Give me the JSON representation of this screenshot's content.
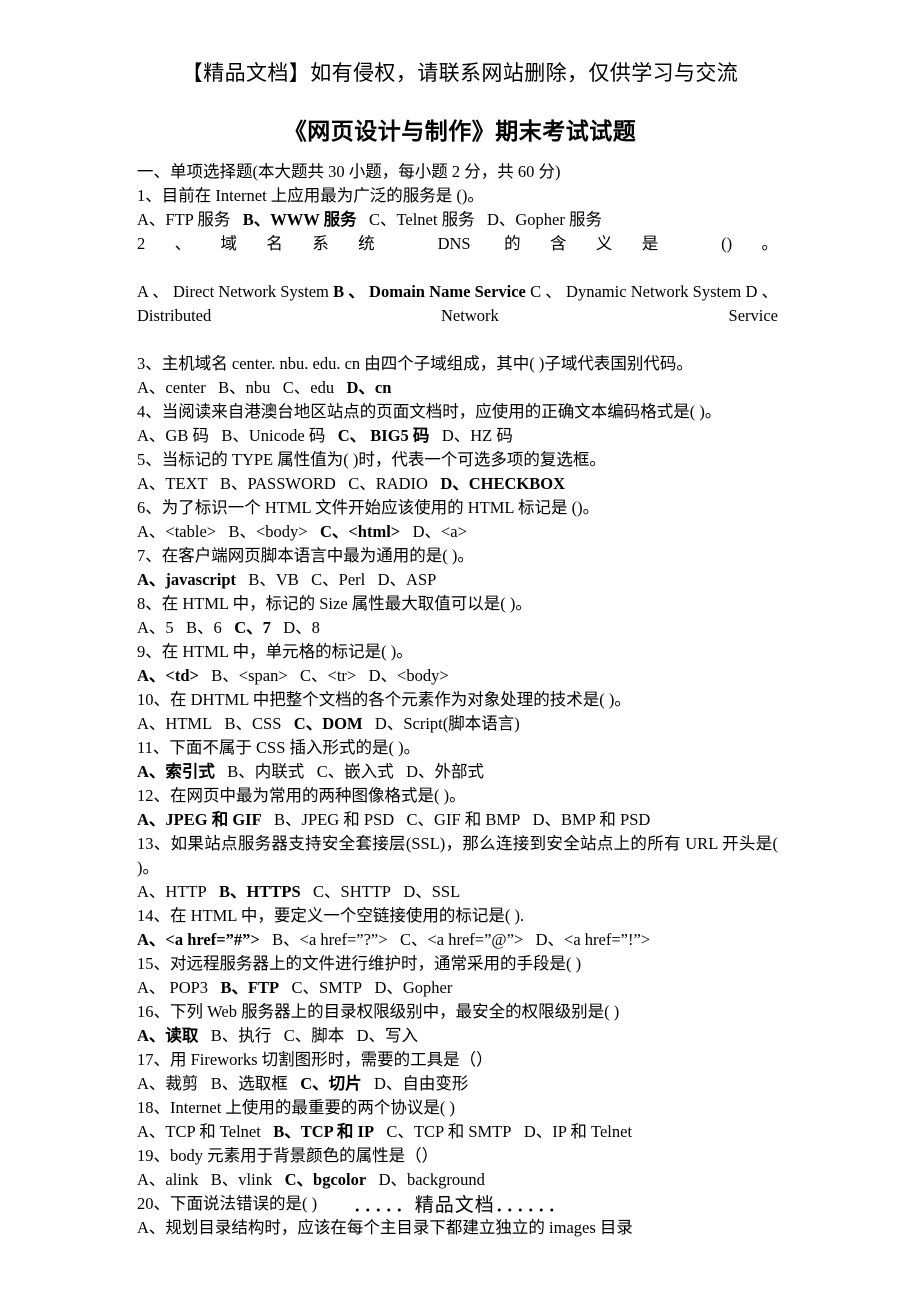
{
  "header": {
    "notice": "【精品文档】如有侵权，请联系网站删除，仅供学习与交流"
  },
  "title": "《网页设计与制作》期末考试试题",
  "section_heading": "一、单项选择题(本大题共 30 小题，每小题 2 分，共 60 分)",
  "questions": [
    {
      "number": "1",
      "stem": "1、目前在 Internet 上应用最为广泛的服务是 ()。",
      "options_text": "A、FTP 服务　B、WWW 服务　C、Telnet 服务　D、Gopher 服务",
      "options": [
        {
          "label": "A、FTP 服务",
          "bold": false
        },
        {
          "label": "B、WWW 服务",
          "bold": true
        },
        {
          "label": "C、Telnet 服务",
          "bold": false
        },
        {
          "label": "D、Gopher 服务",
          "bold": false
        }
      ],
      "answer": "B"
    },
    {
      "number": "2",
      "stem": "2、域名系统 DNS 的含义是 ()。",
      "options_text": "A、Direct Network System B、Domain Name Service C、Dynamic Network System D、Distributed Network Service",
      "options": [
        {
          "label": "A 、 Direct Network System",
          "bold": false
        },
        {
          "label": "B 、 Domain Name Service",
          "bold": true
        },
        {
          "label": "C 、 Dynamic Network System",
          "bold": false
        },
        {
          "label": "D 、 Distributed Network Service",
          "bold": false
        }
      ],
      "answer": "B",
      "wraps": true
    },
    {
      "number": "3",
      "stem": "3、主机域名 center. nbu. edu. cn 由四个子域组成，其中( )子域代表国别代码。",
      "options_text": "A、center　B、nbu　C、edu　D、cn",
      "options": [
        {
          "label": "A、center",
          "bold": false
        },
        {
          "label": "B、nbu",
          "bold": false
        },
        {
          "label": "C、edu",
          "bold": false
        },
        {
          "label": "D、cn",
          "bold": true
        }
      ],
      "answer": "D"
    },
    {
      "number": "4",
      "stem": "4、当阅读来自港澳台地区站点的页面文档时，应使用的正确文本编码格式是( )。",
      "options_text": "A、GB 码 B、Unicode 码 C、 BIG5 码 D、HZ 码",
      "options": [
        {
          "label": "A、GB 码",
          "bold": false
        },
        {
          "label": "B、Unicode 码",
          "bold": false
        },
        {
          "label": "C、 BIG5 码",
          "bold": true
        },
        {
          "label": "D、HZ 码",
          "bold": false
        }
      ],
      "answer": "C"
    },
    {
      "number": "5",
      "stem": "5、当标记的 TYPE 属性值为( )时，代表一个可选多项的复选框。",
      "options_text": "A、TEXT　B、PASSWORD　C、RADIO　D、CHECKBOX",
      "options": [
        {
          "label": "A、TEXT",
          "bold": false
        },
        {
          "label": "B、PASSWORD",
          "bold": false
        },
        {
          "label": "C、RADIO",
          "bold": false
        },
        {
          "label": "D、CHECKBOX",
          "bold": true
        }
      ],
      "answer": "D"
    },
    {
      "number": "6",
      "stem": "6、为了标识一个 HTML 文件开始应该使用的 HTML 标记是 ()。",
      "options_text": "A、<table>　B、<body>　C、<html>　D、<a>",
      "options": [
        {
          "label": "A、<table>",
          "bold": false
        },
        {
          "label": "B、<body>",
          "bold": false
        },
        {
          "label": "C、<html>",
          "bold": true
        },
        {
          "label": "D、<a>",
          "bold": false
        }
      ],
      "answer": "C"
    },
    {
      "number": "7",
      "stem": "7、在客户端网页脚本语言中最为通用的是( )。",
      "options_text": "A、javascript　B、VB　C、Perl　D、ASP",
      "options": [
        {
          "label": "A、javascript",
          "bold": true
        },
        {
          "label": "B、VB",
          "bold": false
        },
        {
          "label": "C、Perl",
          "bold": false
        },
        {
          "label": "D、ASP",
          "bold": false
        }
      ],
      "answer": "A"
    },
    {
      "number": "8",
      "stem": "8、在 HTML 中，标记的 Size 属性最大取值可以是( )。",
      "options_text": "A、5　B、6　C、7　D、8",
      "options": [
        {
          "label": "A、5",
          "bold": false
        },
        {
          "label": "B、6",
          "bold": false
        },
        {
          "label": "C、7",
          "bold": true
        },
        {
          "label": "D、8",
          "bold": false
        }
      ],
      "answer": "C"
    },
    {
      "number": "9",
      "stem": "9、在 HTML 中，单元格的标记是( )。",
      "options_text": "A、<td>　B、<span>　C、<tr>　D、<body>",
      "options": [
        {
          "label": "A、<td>",
          "bold": true
        },
        {
          "label": "B、<span>",
          "bold": false
        },
        {
          "label": "C、<tr>",
          "bold": false
        },
        {
          "label": "D、<body>",
          "bold": false
        }
      ],
      "answer": "A"
    },
    {
      "number": "10",
      "stem": "10、在 DHTML 中把整个文档的各个元素作为对象处理的技术是( )。",
      "options_text": "A、HTML　B、CSS　C、DOM　D、Script(脚本语言)",
      "options": [
        {
          "label": "A、HTML",
          "bold": false
        },
        {
          "label": "B、CSS",
          "bold": false
        },
        {
          "label": "C、DOM",
          "bold": true
        },
        {
          "label": "D、Script(脚本语言)",
          "bold": false
        }
      ],
      "answer": "C"
    },
    {
      "number": "11",
      "stem": "11、下面不属于 CSS 插入形式的是( )。",
      "options_text": "A、索引式　B、内联式　C、嵌入式　D、外部式",
      "options": [
        {
          "label": "A、索引式",
          "bold": true
        },
        {
          "label": "B、内联式",
          "bold": false
        },
        {
          "label": "C、嵌入式",
          "bold": false
        },
        {
          "label": "D、外部式",
          "bold": false
        }
      ],
      "answer": "A"
    },
    {
      "number": "12",
      "stem": "12、在网页中最为常用的两种图像格式是( )。",
      "options_text": "A、JPEG 和 GIF　B、JPEG 和 PSD　C、GIF 和 BMP　D、BMP 和 PSD",
      "options": [
        {
          "label": "A、JPEG 和 GIF",
          "bold": true
        },
        {
          "label": "B、JPEG 和 PSD",
          "bold": false
        },
        {
          "label": "C、GIF 和 BMP",
          "bold": false
        },
        {
          "label": "D、BMP 和 PSD",
          "bold": false
        }
      ],
      "answer": "A"
    },
    {
      "number": "13",
      "stem": "13、如果站点服务器支持安全套接层(SSL)，那么连接到安全站点上的所有 URL 开头是( )。",
      "options_text": "A、HTTP　B、HTTPS　C、SHTTP　D、SSL",
      "options": [
        {
          "label": "A、HTTP",
          "bold": false
        },
        {
          "label": "B、HTTPS",
          "bold": true
        },
        {
          "label": "C、SHTTP",
          "bold": false
        },
        {
          "label": "D、SSL",
          "bold": false
        }
      ],
      "answer": "B"
    },
    {
      "number": "14",
      "stem": "14、在 HTML 中，要定义一个空链接使用的标记是( ).",
      "options_text": "A、<a href=”#”>　B、<a href=”?”>　C、<a href=”@”>　D、<a href=”!”>",
      "options": [
        {
          "label": "A、<a href=”#”>",
          "bold": true
        },
        {
          "label": "B、<a href=”?”>",
          "bold": false
        },
        {
          "label": "C、<a href=”@”>",
          "bold": false
        },
        {
          "label": "D、<a href=”!”>",
          "bold": false
        }
      ],
      "answer": "A"
    },
    {
      "number": "15",
      "stem": "15、对远程服务器上的文件进行维护时，通常采用的手段是( )",
      "options_text": "A、 POP3　B、FTP　C、SMTP　D、Gopher",
      "options": [
        {
          "label": "A、 POP3",
          "bold": false
        },
        {
          "label": "B、FTP",
          "bold": true
        },
        {
          "label": "C、SMTP",
          "bold": false
        },
        {
          "label": "D、Gopher",
          "bold": false
        }
      ],
      "answer": "B"
    },
    {
      "number": "16",
      "stem": "16、下列 Web 服务器上的目录权限级别中，最安全的权限级别是( )",
      "options_text": "A、读取　B、执行　C、脚本　D、写入",
      "options": [
        {
          "label": "A、读取",
          "bold": true
        },
        {
          "label": "B、执行",
          "bold": false
        },
        {
          "label": "C、脚本",
          "bold": false
        },
        {
          "label": "D、写入",
          "bold": false
        }
      ],
      "answer": "A"
    },
    {
      "number": "17",
      "stem": "17、用 Fireworks 切割图形时，需要的工具是（）",
      "options_text": "A、裁剪　B、选取框　C、切片　D、自由变形",
      "options": [
        {
          "label": "A、裁剪",
          "bold": false
        },
        {
          "label": "B、选取框",
          "bold": false
        },
        {
          "label": "C、切片",
          "bold": true
        },
        {
          "label": "D、自由变形",
          "bold": false
        }
      ],
      "answer": "C"
    },
    {
      "number": "18",
      "stem": "18、Internet 上使用的最重要的两个协议是( )",
      "options_text": "A、TCP 和 Telnet　B、TCP 和 IP　C、TCP 和 SMTP　D、IP 和 Telnet",
      "options": [
        {
          "label": "A、TCP 和 Telnet",
          "bold": false
        },
        {
          "label": "B、TCP 和 IP",
          "bold": true
        },
        {
          "label": "C、TCP 和 SMTP",
          "bold": false
        },
        {
          "label": "D、IP 和 Telnet",
          "bold": false
        }
      ],
      "answer": "B"
    },
    {
      "number": "19",
      "stem": "19、body 元素用于背景颜色的属性是（）",
      "options_text": "A、alink　B、vlink　C、bgcolor　D、background",
      "options": [
        {
          "label": "A、alink",
          "bold": false
        },
        {
          "label": "B、vlink",
          "bold": false
        },
        {
          "label": "C、bgcolor",
          "bold": true
        },
        {
          "label": "D、background",
          "bold": false
        }
      ],
      "answer": "C"
    },
    {
      "number": "20",
      "stem": "20、下面说法错误的是( )",
      "options_text": "A、规划目录结构时，应该在每个主目录下都建立独立的 images 目录",
      "options": [
        {
          "label": "A、规划目录结构时，应该在每个主目录下都建立独立的 images 目录",
          "bold": false
        }
      ],
      "answer": ""
    }
  ],
  "footer": "．．．．．精品文档．．．．．．"
}
